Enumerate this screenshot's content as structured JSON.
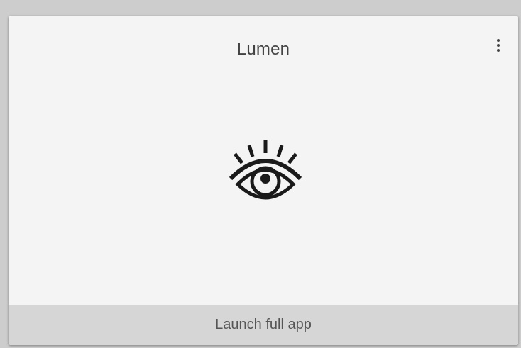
{
  "card": {
    "title": "Lumen",
    "menu_icon": "more-vert-icon",
    "logo_icon": "eye-icon",
    "launch_label": "Launch full app"
  },
  "colors": {
    "page_background": "#cdcdcd",
    "card_background": "#f4f4f4",
    "footer_background": "#d6d6d6",
    "title_text": "#424242",
    "footer_text": "#555555"
  }
}
